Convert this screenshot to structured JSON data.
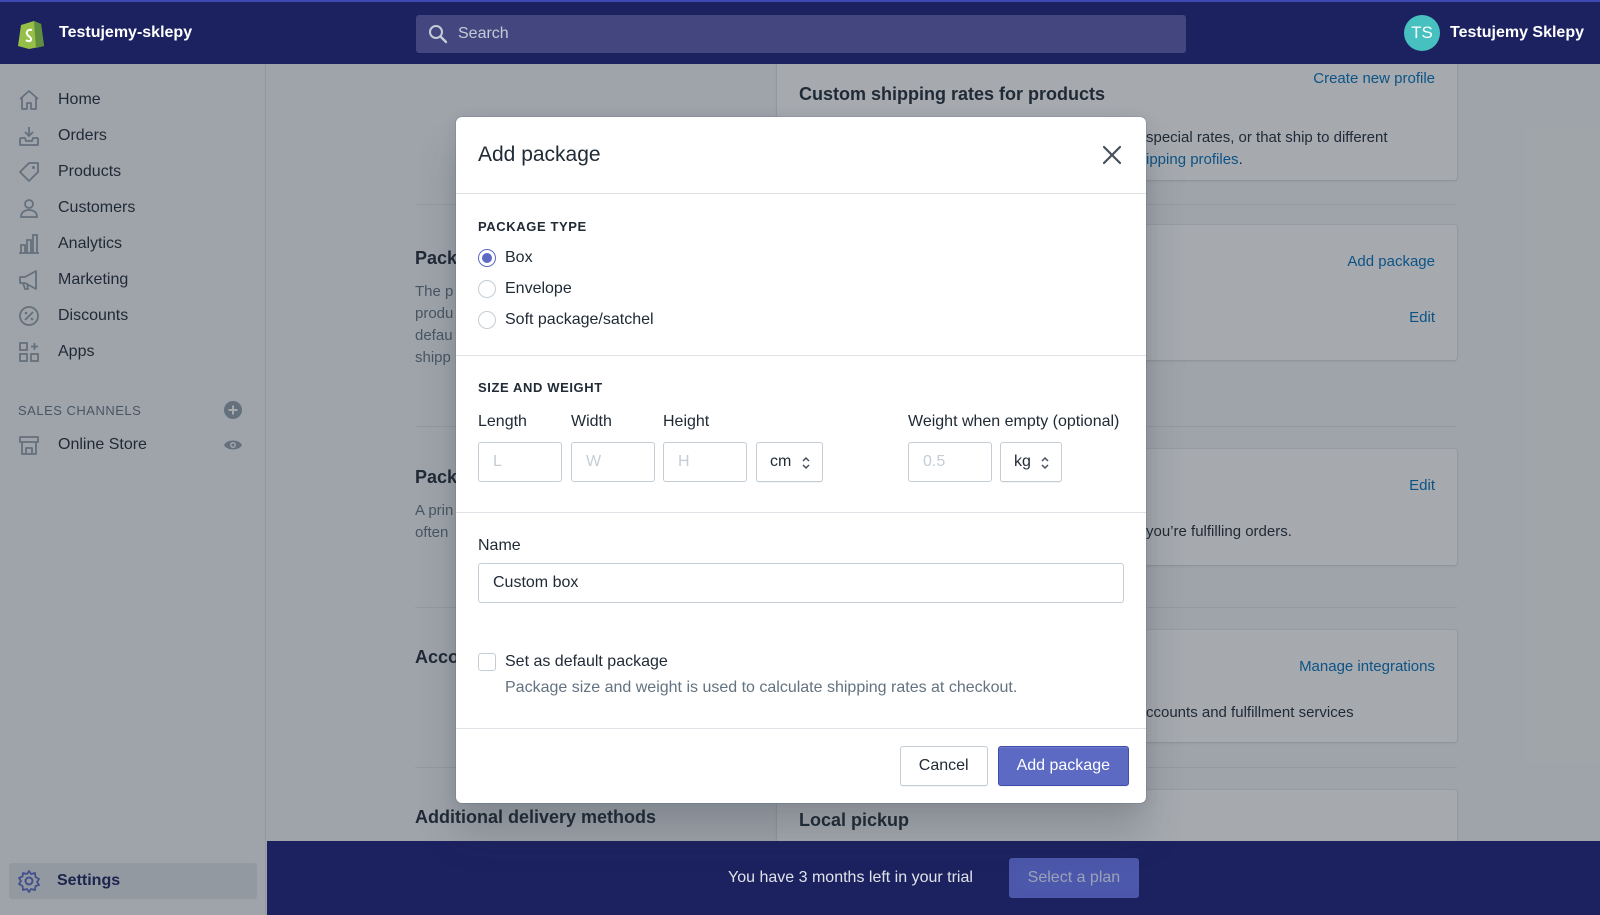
{
  "topbar": {
    "store_name": "Testujemy-sklepy",
    "search_placeholder": "Search",
    "user_initials": "TS",
    "user_name": "Testujemy Sklepy"
  },
  "sidebar": {
    "items": [
      {
        "label": "Home",
        "icon": "home-icon"
      },
      {
        "label": "Orders",
        "icon": "orders-icon"
      },
      {
        "label": "Products",
        "icon": "tag-icon"
      },
      {
        "label": "Customers",
        "icon": "person-icon"
      },
      {
        "label": "Analytics",
        "icon": "bar-chart-icon"
      },
      {
        "label": "Marketing",
        "icon": "megaphone-icon"
      },
      {
        "label": "Discounts",
        "icon": "discount-icon"
      },
      {
        "label": "Apps",
        "icon": "apps-icon"
      }
    ],
    "sales_channels_heading": "SALES CHANNELS",
    "online_store_label": "Online Store",
    "settings_label": "Settings"
  },
  "background": {
    "custom_rates_title": "Custom shipping rates for products",
    "create_profile_link": "Create new profile",
    "custom_rates_text_1": "special rates, or that ship to different",
    "custom_rates_text_2": "ipping profiles",
    "custom_rates_text_2_end": ".",
    "packages_heading_partial": "Pack",
    "packages_desc_partial": [
      "The p",
      "produ",
      "defau",
      "shipp"
    ],
    "add_package_link": "Add package",
    "edit_link_1": "Edit",
    "packing_heading_partial": "Pack",
    "packing_desc_partial": [
      "A prin",
      "often"
    ],
    "edit_link_2": "Edit",
    "packing_text": "you’re fulfilling orders.",
    "accounts_heading_partial": "Acco",
    "manage_integrations_link": "Manage integrations",
    "accounts_text": "ccounts and fulfillment services",
    "additional_delivery_heading": "Additional delivery methods",
    "local_pickup_title": "Local pickup"
  },
  "modal": {
    "title": "Add package",
    "package_type_heading": "PACKAGE TYPE",
    "package_types": [
      "Box",
      "Envelope",
      "Soft package/satchel"
    ],
    "selected_type_index": 0,
    "size_weight_heading": "SIZE AND WEIGHT",
    "length_label": "Length",
    "length_placeholder": "L",
    "width_label": "Width",
    "width_placeholder": "W",
    "height_label": "Height",
    "height_placeholder": "H",
    "dimension_unit": "cm",
    "weight_label": "Weight when empty (optional)",
    "weight_placeholder": "0.5",
    "weight_unit": "kg",
    "name_label": "Name",
    "name_value": "Custom box",
    "default_checkbox_label": "Set as default package",
    "default_checked": false,
    "help_text": "Package size and weight is used to calculate shipping rates at checkout.",
    "cancel_label": "Cancel",
    "submit_label": "Add package"
  },
  "trial": {
    "text": "You have 3 months left in your trial",
    "button_label": "Select a plan"
  },
  "colors": {
    "topbar": "#1c2260",
    "primary": "#5c6ac4",
    "link": "#006fbb",
    "avatar": "#47c1bf"
  }
}
